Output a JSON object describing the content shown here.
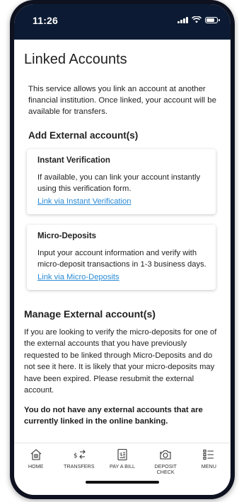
{
  "status_bar": {
    "time": "11:26"
  },
  "page": {
    "title": "Linked Accounts",
    "intro": "This service allows you link an account at another financial institution. Once linked, your account will be available for transfers.",
    "add_heading": "Add External account(s)",
    "cards": [
      {
        "title": "Instant Verification",
        "text": "If available, you can link your account instantly using this verification form.",
        "link": "Link via Instant Verification"
      },
      {
        "title": "Micro-Deposits",
        "text": "Input your account information and verify with micro-deposit transactions in 1-3 business days.",
        "link": "Link via Micro-Deposits"
      }
    ],
    "manage_heading": "Manage External account(s)",
    "manage_text": "If you are looking to verify the micro-deposits for one of the external accounts that you have previously requested to be linked through Micro-Deposits and do not see it here. It is likely that your micro-deposits may have been expired. Please resubmit the external account.",
    "no_accounts": "You do not have any external accounts that are currently linked in the online banking."
  },
  "tabbar": {
    "items": [
      {
        "label": "HOME",
        "icon": "home-icon"
      },
      {
        "label": "TRANSFERS",
        "icon": "transfer-icon"
      },
      {
        "label": "PAY A BILL",
        "icon": "bill-icon"
      },
      {
        "label": "DEPOSIT CHECK",
        "icon": "camera-icon"
      },
      {
        "label": "MENU",
        "icon": "menu-icon"
      }
    ]
  },
  "colors": {
    "status_bar": "#0c1b33",
    "link": "#2a8bd6"
  }
}
